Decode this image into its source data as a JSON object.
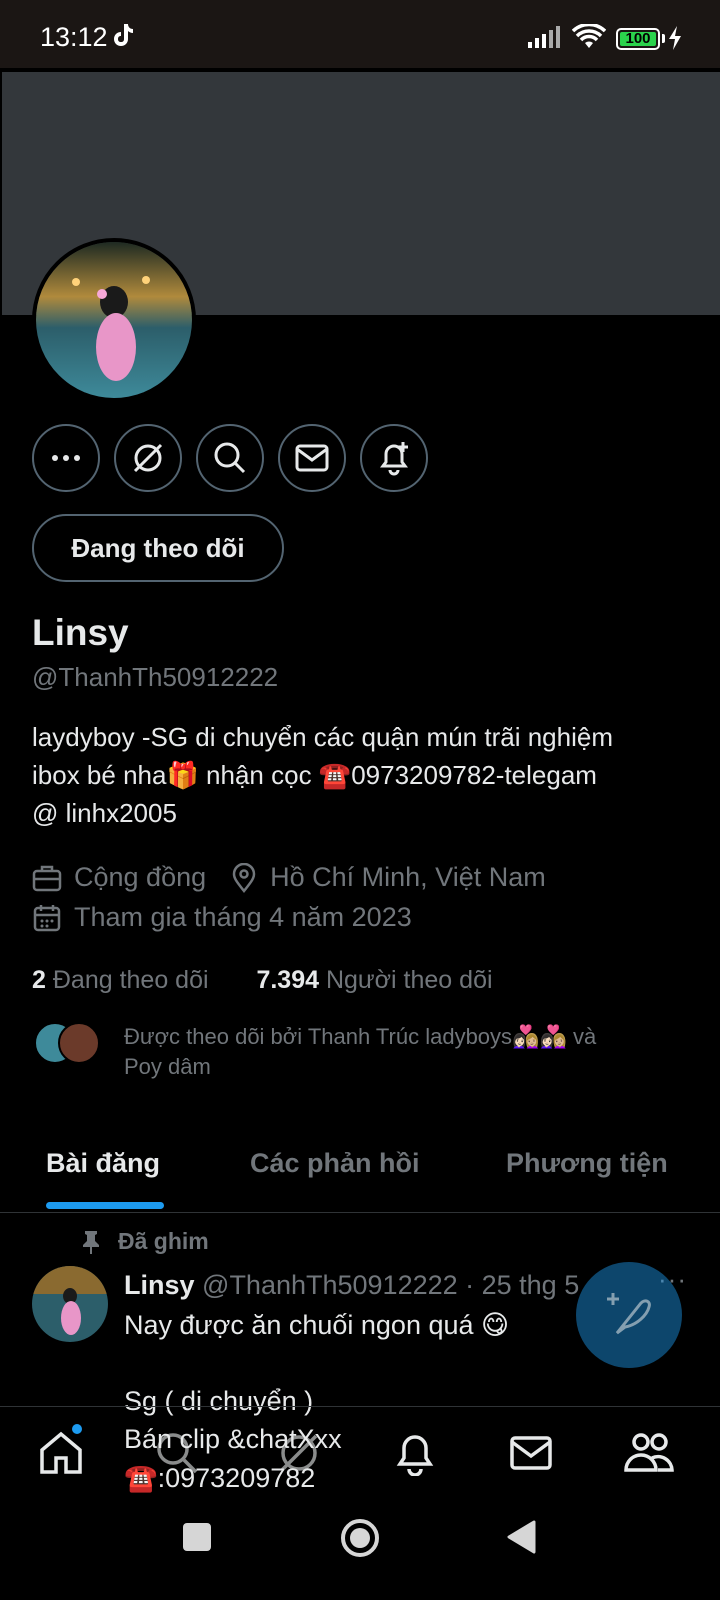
{
  "status_bar": {
    "time": "13:12",
    "battery": "100",
    "icons": [
      "tiktok-icon",
      "signal-icon",
      "wifi-icon",
      "battery-icon",
      "charging-bolt-icon"
    ]
  },
  "profile": {
    "display_name": "Linsy",
    "handle": "@ThanhTh50912222",
    "bio_line1": "laydyboy -SG di chuyển các quận mún trãi nghiệm",
    "bio_line2a": "ibox bé nha",
    "bio_gift": "🎁",
    "bio_line2b": " nhận cọc ",
    "bio_phone_icon": "☎️",
    "bio_line2c": "0973209782-telegam",
    "bio_line3": "@ linhx2005",
    "category": "Cộng đồng",
    "location": "Hồ Chí Minh, Việt Nam",
    "joined": "Tham gia tháng 4 năm 2023"
  },
  "actions": {
    "more": "more-icon",
    "grok": "grok-icon",
    "search": "search-icon",
    "message": "mail-icon",
    "notify": "bell-plus-icon",
    "follow_label": "Đang theo dõi"
  },
  "stats": {
    "following_count": "2",
    "following_label": "Đang theo dõi",
    "followers_count": "7.394",
    "followers_label": "Người theo dõi"
  },
  "followed_by": {
    "text": "Được theo dõi bởi Thanh Trúc ladyboys",
    "emojis": "👩🏻‍❤️‍👩🏼👩🏻‍❤️‍👩🏼",
    "text2": " và",
    "text3": "Poy dâm"
  },
  "tabs": [
    {
      "label": "Bài đăng",
      "active": true
    },
    {
      "label": "Các phản hồi",
      "active": false
    },
    {
      "label": "Phương tiện",
      "active": false
    }
  ],
  "post": {
    "pinned_label": "Đã ghim",
    "author": "Linsy",
    "meta": " @ThanhTh50912222 · 25 thg 5",
    "more": "···",
    "line1": "Nay được ăn chuối ngon quá 😋",
    "line2": "Sg ( di chuyển )",
    "line3": "Bán clip &chatXxx",
    "line4": "☎️:0973209782"
  },
  "bottom_nav": [
    "home-icon",
    "search-icon",
    "grok-icon",
    "bell-icon",
    "mail-icon",
    "communities-icon"
  ],
  "system_nav": [
    "square-button",
    "home-circle-button",
    "back-triangle-button"
  ],
  "colors": {
    "accent": "#1d9bf0",
    "border": "#536471",
    "secondary_text": "#71767b",
    "banner": "#33373b"
  }
}
